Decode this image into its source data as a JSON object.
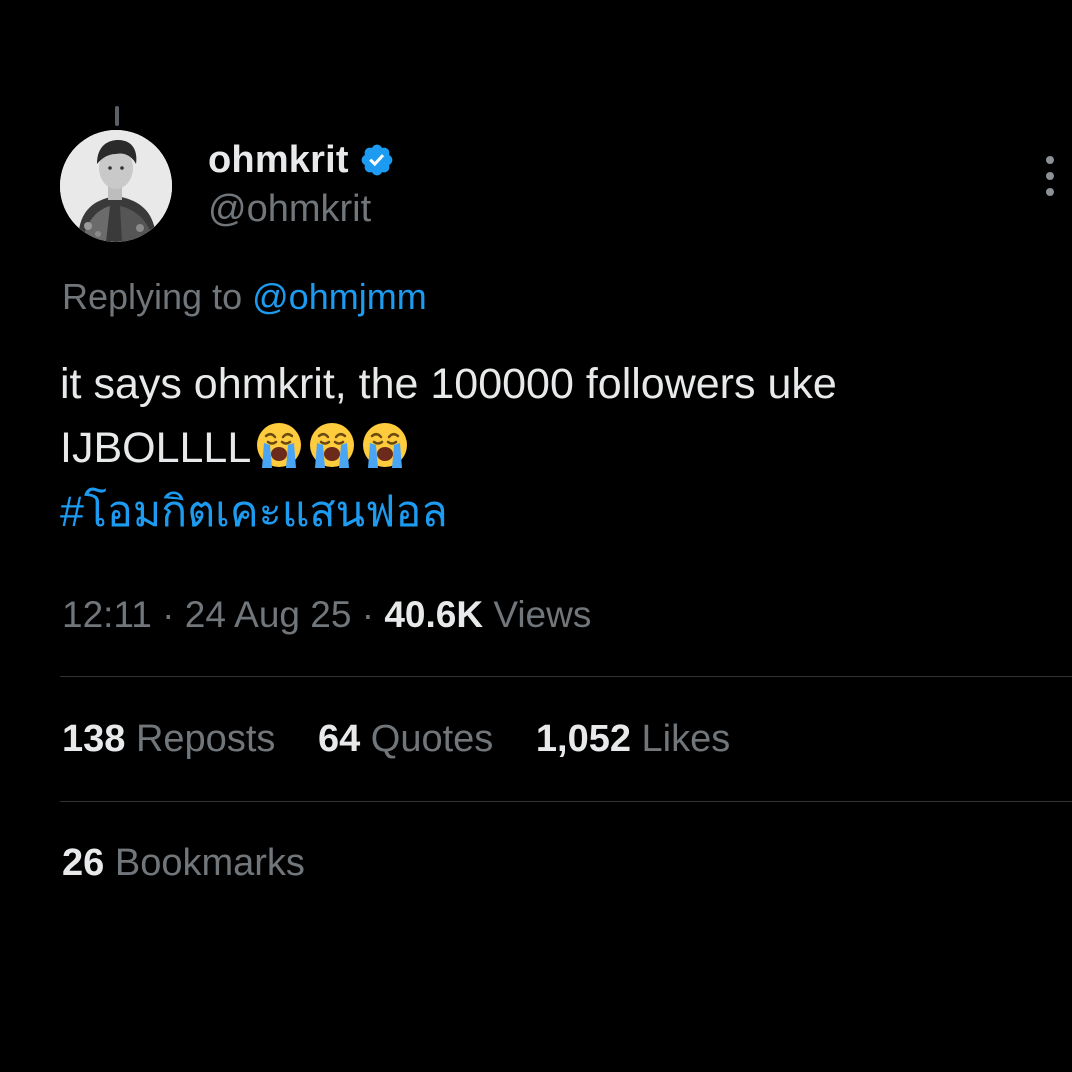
{
  "author": {
    "display_name": "ohmkrit",
    "handle": "@ohmkrit",
    "verified": true
  },
  "reply": {
    "prefix": "Replying to",
    "mention": "@ohmjmm"
  },
  "tweet": {
    "line1": "it says ohmkrit, the 100000 followers uke",
    "line2": "IJBOLLLL",
    "emoji_count": 3,
    "emoji_name": "loudly-crying-face",
    "hashtag": "#โอมกิตเคะแสนฟอล"
  },
  "meta": {
    "time": "12:11",
    "sep1": "·",
    "date": "24 Aug 25",
    "sep2": "·",
    "views_count": "40.6K",
    "views_label": "Views"
  },
  "stats": {
    "reposts_count": "138",
    "reposts_label": "Reposts",
    "quotes_count": "64",
    "quotes_label": "Quotes",
    "likes_count": "1,052",
    "likes_label": "Likes",
    "bookmarks_count": "26",
    "bookmarks_label": "Bookmarks"
  },
  "colors": {
    "background": "#000000",
    "text": "#e7e9ea",
    "muted": "#71767b",
    "accent": "#1d9bf0",
    "divider": "#2f3336"
  }
}
